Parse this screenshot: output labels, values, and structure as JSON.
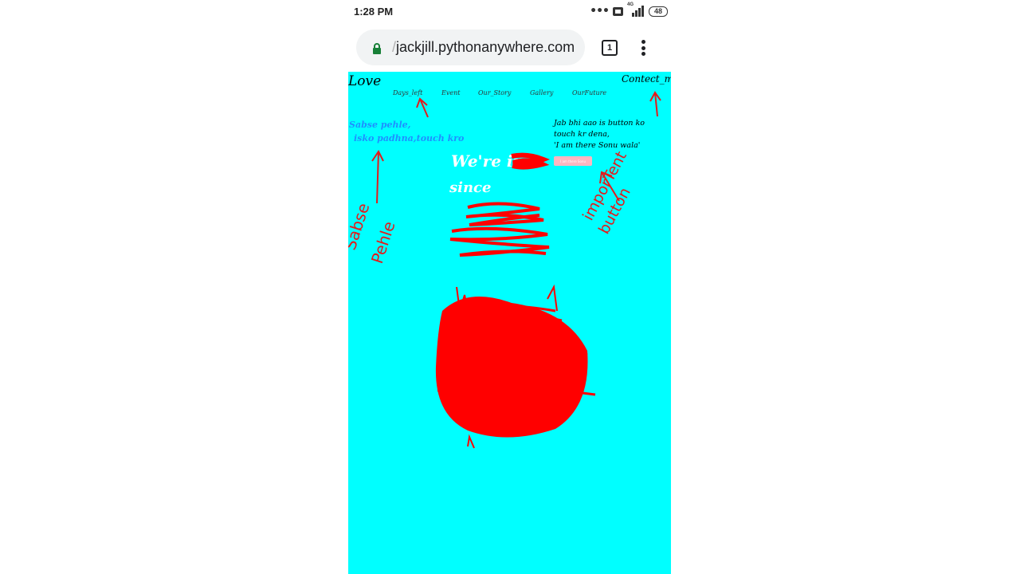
{
  "status_bar": {
    "time": "1:28 PM",
    "network": "4G",
    "battery": "48"
  },
  "browser": {
    "url_prefix": "/",
    "url_host": "jackjill.pythonanywhere.com",
    "tab_count": "1"
  },
  "site": {
    "logo": "Love",
    "contact": "Contect_me",
    "nav": [
      "Days_left",
      "Event",
      "Our_Story",
      "Gallery",
      "OurFuture"
    ],
    "left_note": [
      "Sabse pehle,",
      "isko padhna,touch kro"
    ],
    "right_note": [
      "Jab bhi aao is button ko",
      "touch kr dena,",
      "'I am there Sonu wala'"
    ],
    "special_button": "I am there Sonu",
    "hero_line1": "We're in",
    "hero_line2": "since"
  },
  "annotations": {
    "left_scribble": [
      "Sabse",
      "Pehle"
    ],
    "right_scribble": [
      "imporTent",
      "button"
    ],
    "colors": {
      "accent": "#ff0000",
      "page_bg": "#00ffff"
    }
  }
}
